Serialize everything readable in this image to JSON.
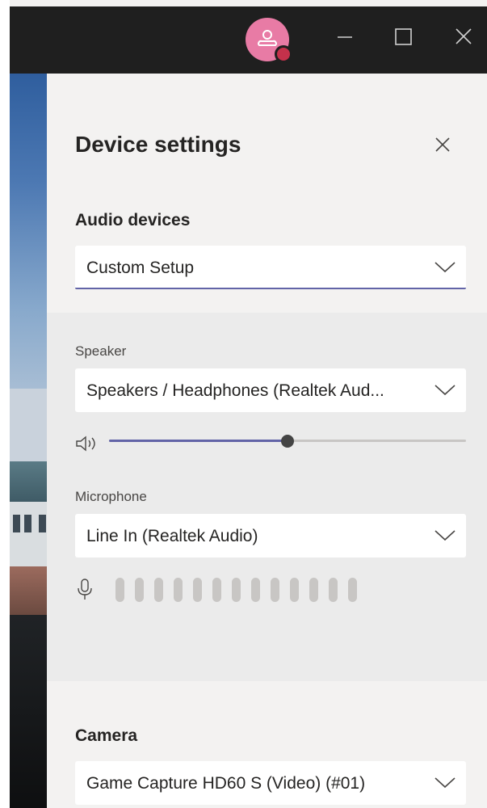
{
  "window": {
    "avatar_icon": "person-icon",
    "presence_color": "#c4314b",
    "controls": [
      "minimize-icon",
      "maximize-icon",
      "close-icon"
    ]
  },
  "panel": {
    "title": "Device settings",
    "audio": {
      "label": "Audio devices",
      "selected": "Custom Setup"
    },
    "speaker": {
      "label": "Speaker",
      "selected": "Speakers / Headphones (Realtek Aud...",
      "volume_percent": 50
    },
    "microphone": {
      "label": "Line In (Realtek Audio)",
      "field_label": "Microphone",
      "level_bars": 13,
      "level_active": 0
    },
    "camera": {
      "label": "Camera",
      "selected": "Game Capture HD60 S (Video) (#01)"
    }
  },
  "colors": {
    "accent": "#6264a7",
    "titlebar": "#1f1f1f",
    "panel_bg": "#f3f2f1",
    "band_bg": "#ebebeb"
  }
}
